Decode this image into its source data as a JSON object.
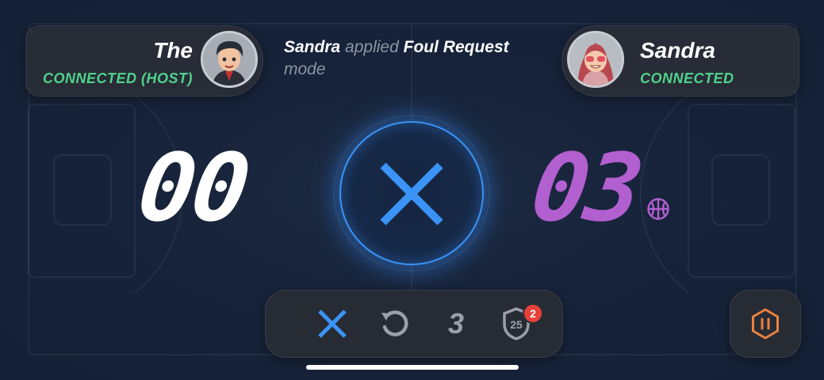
{
  "players": {
    "left": {
      "name": "The",
      "status": "CONNECTED (HOST)",
      "avatar_icon": "boy-avatar-icon"
    },
    "right": {
      "name": "Sandra",
      "status": "CONNECTED",
      "avatar_icon": "girl-avatar-icon"
    }
  },
  "message": {
    "actor": "Sandra",
    "verb": "applied",
    "action": "Foul Request",
    "suffix": "mode"
  },
  "scores": {
    "left": "00",
    "right": "03"
  },
  "toolbar": {
    "count": "3",
    "shield_number": "25",
    "badge_count": "2"
  },
  "colors": {
    "accent_blue": "#3a93f5",
    "connected_green": "#4fd38c",
    "right_score_purple": "#b25fd0",
    "pause_orange": "#e9823f",
    "badge_red": "#e8413a"
  }
}
